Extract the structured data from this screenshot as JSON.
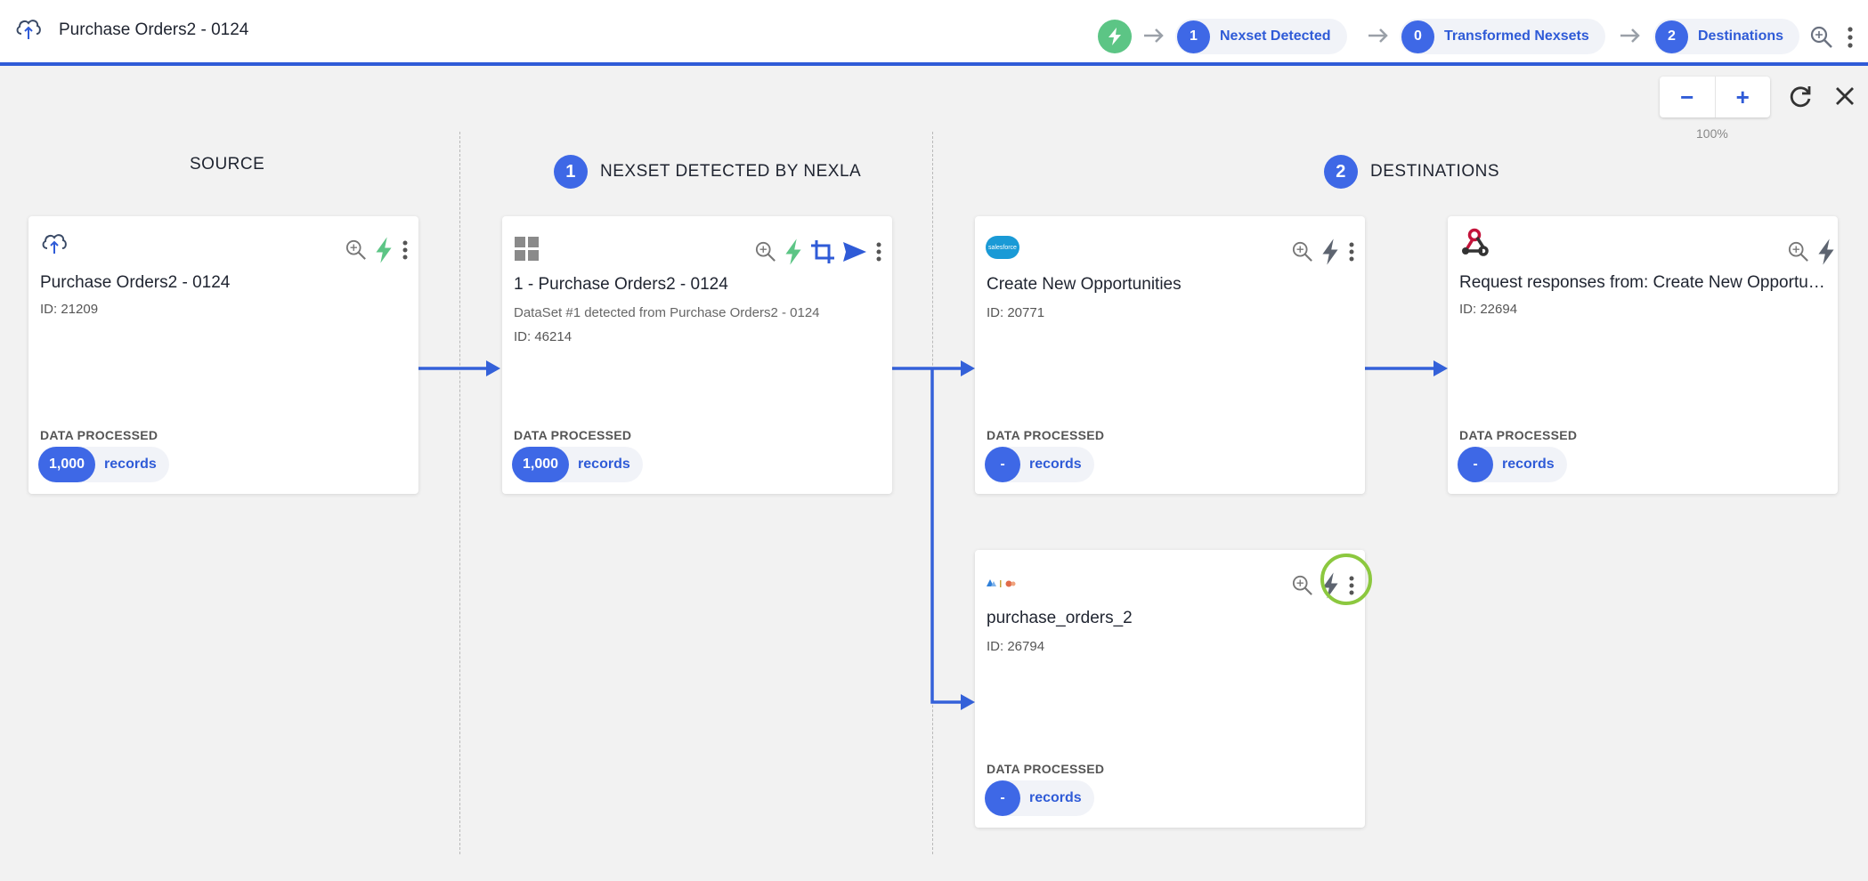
{
  "header": {
    "title": "Purchase Orders2 - 0124",
    "steps": [
      {
        "num": "1",
        "label": "Nexset Detected"
      },
      {
        "num": "0",
        "label": "Transformed Nexsets"
      },
      {
        "num": "2",
        "label": "Destinations"
      }
    ]
  },
  "zoom": {
    "minus": "−",
    "plus": "+",
    "level": "100%"
  },
  "columns": {
    "source": {
      "title": "SOURCE"
    },
    "nexset": {
      "num": "1",
      "title": "NEXSET DETECTED BY NEXLA"
    },
    "destinations": {
      "num": "2",
      "title": "DESTINATIONS"
    }
  },
  "cards": {
    "source": {
      "title": "Purchase Orders2 - 0124",
      "id": "ID: 21209",
      "dp_label": "DATA PROCESSED",
      "count": "1,000",
      "unit": "records"
    },
    "nexset": {
      "title": "1 - Purchase Orders2 - 0124",
      "desc": "DataSet #1 detected from Purchase Orders2 - 0124",
      "id": "ID: 46214",
      "dp_label": "DATA PROCESSED",
      "count": "1,000",
      "unit": "records"
    },
    "salesforce": {
      "logo_text": "salesforce",
      "title": "Create New Opportunities",
      "id": "ID: 20771",
      "dp_label": "DATA PROCESSED",
      "count": "-",
      "unit": "records"
    },
    "webhook": {
      "title": "Request responses from: Create New Opportunities",
      "id": "ID: 22694",
      "dp_label": "DATA PROCESSED",
      "count": "-",
      "unit": "records"
    },
    "purchase": {
      "title": "purchase_orders_2",
      "id": "ID: 26794",
      "dp_label": "DATA PROCESSED",
      "count": "-",
      "unit": "records"
    }
  },
  "colors": {
    "accent": "#2f5bd7",
    "badge": "#3e68e6",
    "active_bolt": "#5cc585",
    "inactive_bolt": "#5d6470",
    "highlight_ring": "#8cc83f"
  },
  "icons": [
    "cloud-upload-icon",
    "bolt-icon",
    "arrow-right-icon",
    "search-icon",
    "more-vert-icon",
    "refresh-icon",
    "close-icon",
    "grid-icon",
    "crop-icon",
    "send-icon",
    "salesforce-logo",
    "webhook-icon",
    "db-logo-icon"
  ]
}
